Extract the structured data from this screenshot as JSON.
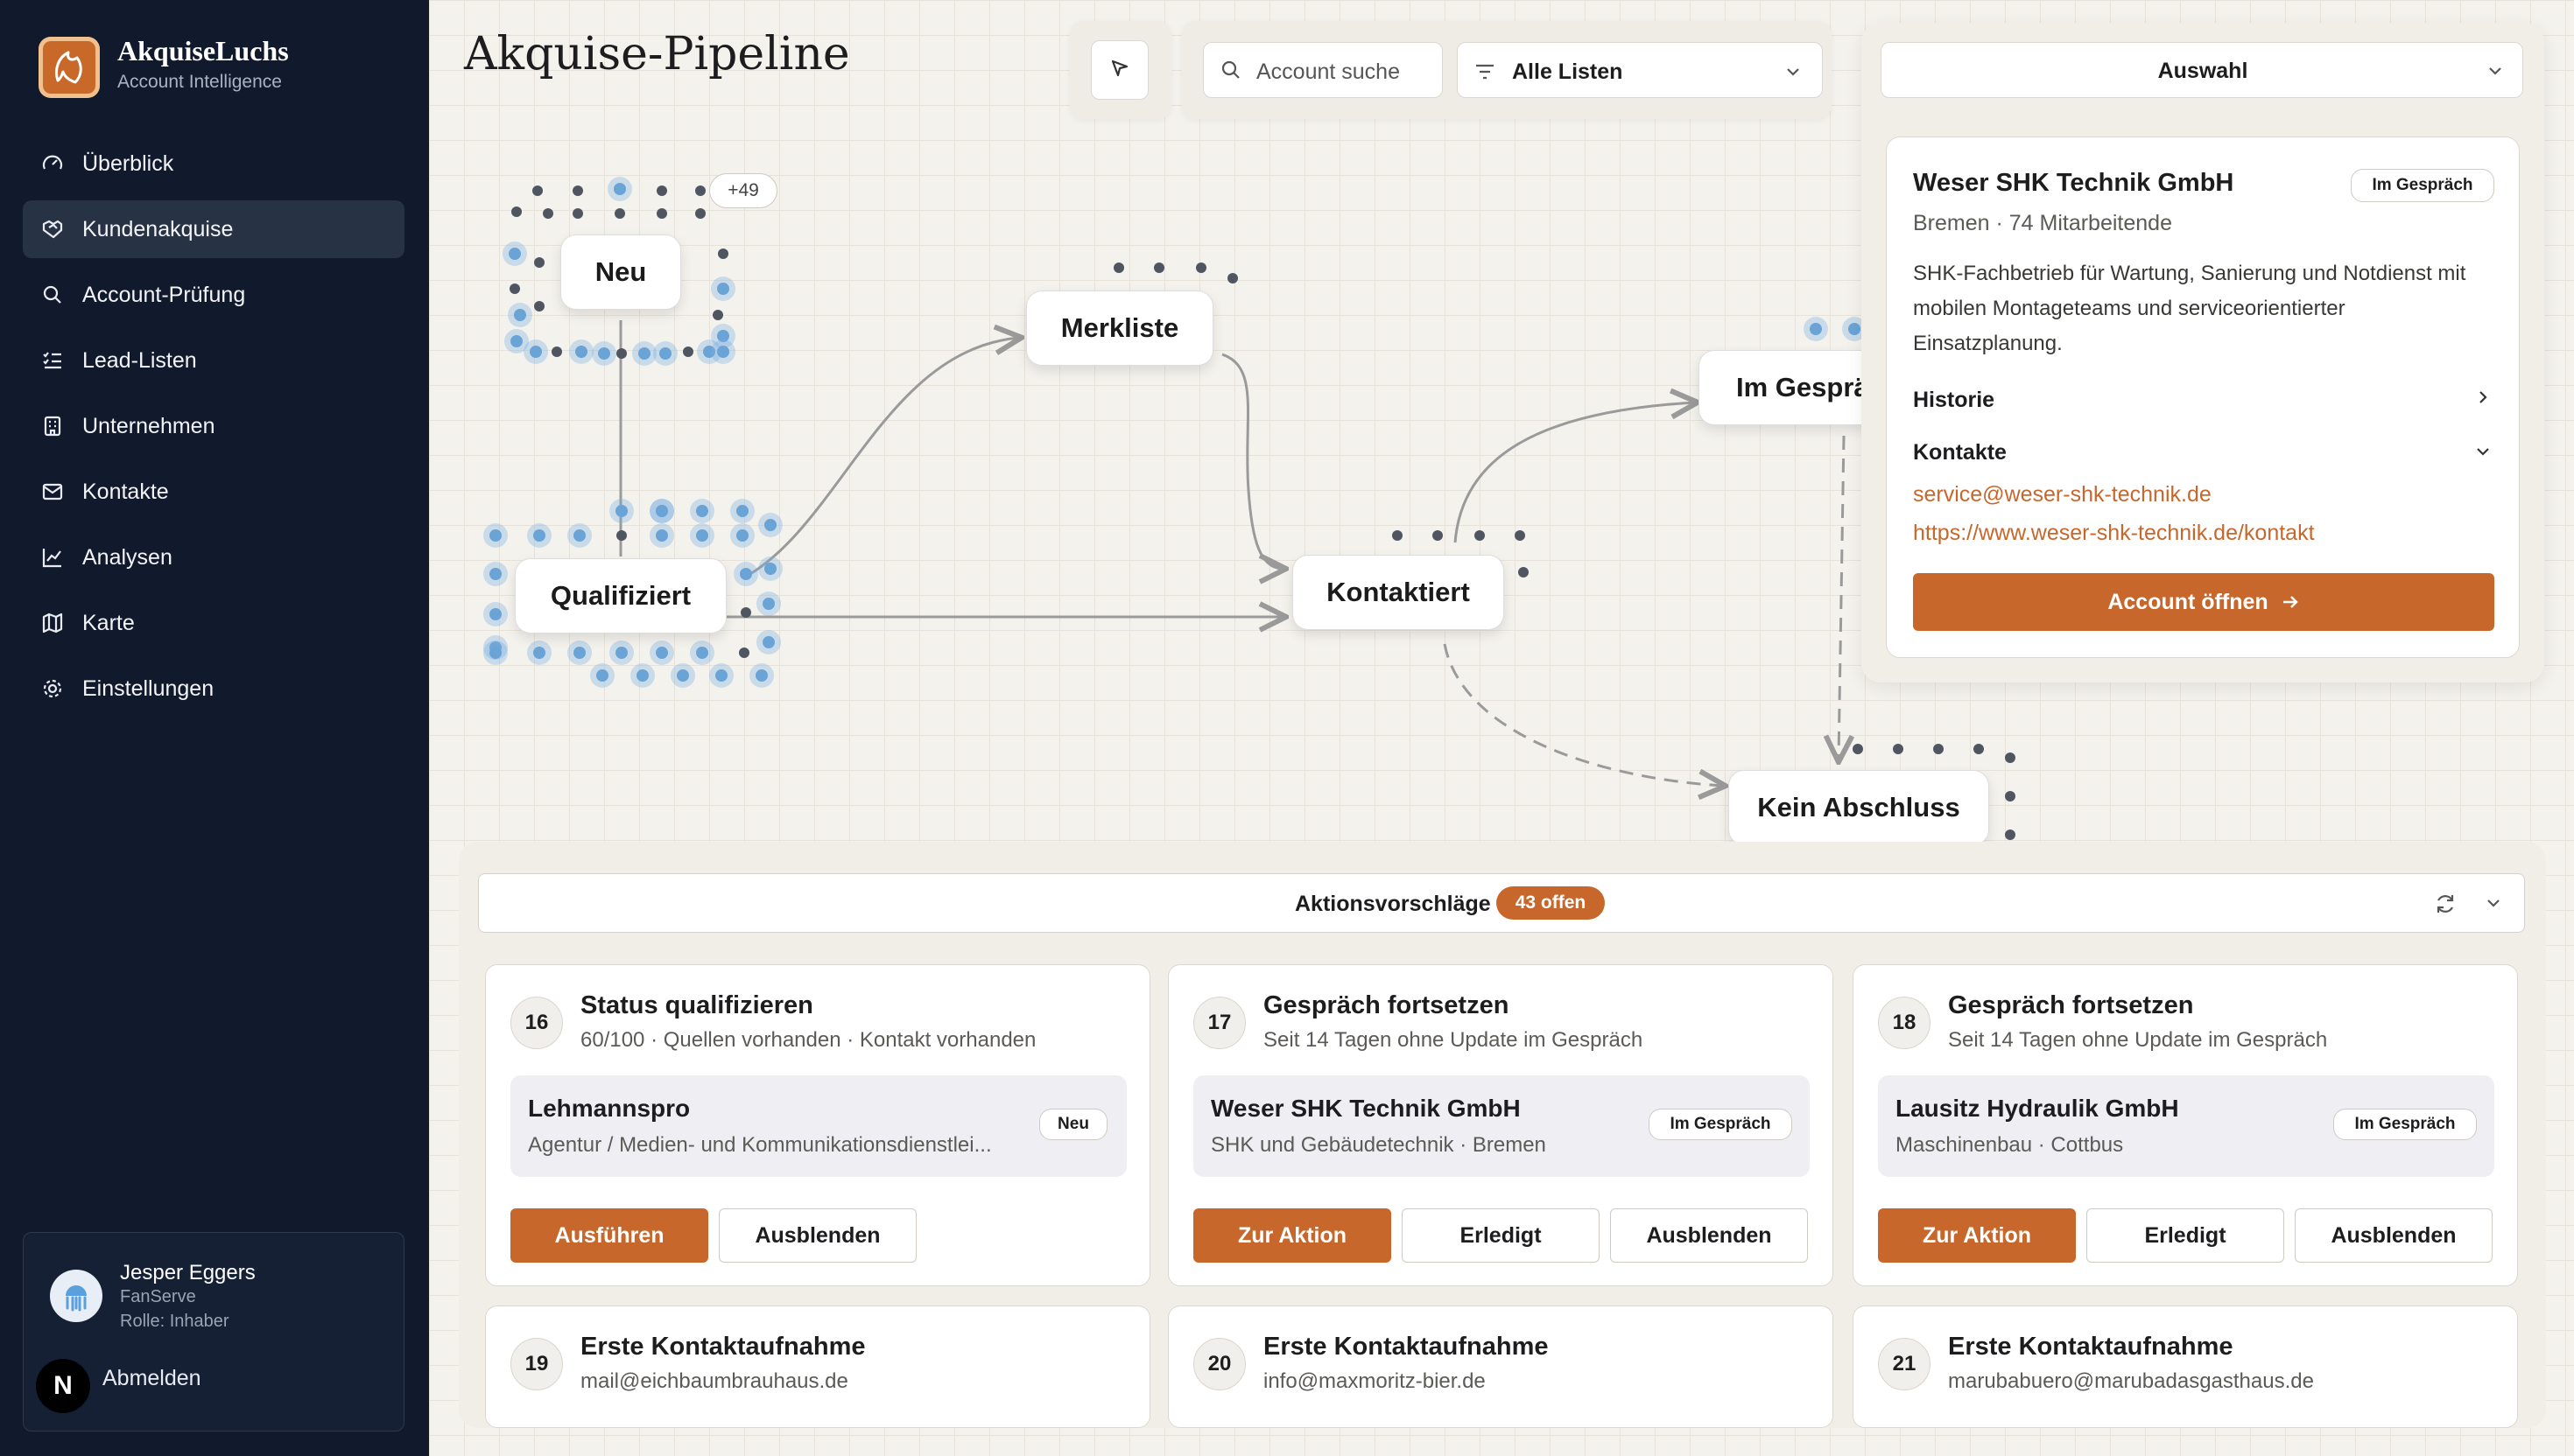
{
  "app": {
    "name": "AkquiseLuchs",
    "subtitle": "Account Intelligence"
  },
  "nav": [
    {
      "label": "Überblick",
      "icon": "gauge-icon",
      "active": false
    },
    {
      "label": "Kundenakquise",
      "icon": "handshake-icon",
      "active": true
    },
    {
      "label": "Account-Prüfung",
      "icon": "search-icon",
      "active": false
    },
    {
      "label": "Lead-Listen",
      "icon": "list-check-icon",
      "active": false
    },
    {
      "label": "Unternehmen",
      "icon": "building-icon",
      "active": false
    },
    {
      "label": "Kontakte",
      "icon": "mail-icon",
      "active": false
    },
    {
      "label": "Analysen",
      "icon": "chart-icon",
      "active": false
    },
    {
      "label": "Karte",
      "icon": "map-icon",
      "active": false
    },
    {
      "label": "Einstellungen",
      "icon": "gear-icon",
      "active": false
    }
  ],
  "user": {
    "name": "Jesper Eggers",
    "org": "FanServe",
    "role": "Rolle: Inhaber",
    "logout": "Abmelden",
    "badge": "N"
  },
  "page": {
    "title": "Akquise-Pipeline"
  },
  "toolbar": {
    "search_placeholder": "Account suche",
    "filter_value": "Alle Listen"
  },
  "pipeline": {
    "nodes": [
      "Neu",
      "Merkliste",
      "Im Gespräch",
      "Qualifiziert",
      "Kontaktiert",
      "Kein Abschluss"
    ],
    "overflow_badge": "+49"
  },
  "selection": {
    "dropdown": "Auswahl",
    "company": "Weser SHK Technik GmbH",
    "status": "Im Gespräch",
    "meta": "Bremen · 74 Mitarbeitende",
    "description": "SHK-Fachbetrieb für Wartung, Sanierung und Notdienst mit mobilen Montageteams und serviceorientierter Einsatzplanung.",
    "history_label": "Historie",
    "contacts_label": "Kontakte",
    "email": "service@weser-shk-technik.de",
    "url": "https://www.weser-shk-technik.de/kontakt",
    "open_button": "Account öffnen"
  },
  "actions": {
    "title": "Aktionsvorschläge",
    "badge": "43 offen",
    "cards": [
      {
        "num": "16",
        "title": "Status qualifizieren",
        "sub": "60/100 · Quellen vorhanden · Kontakt vorhanden",
        "company": "Lehmannspro",
        "company_sub": "Agentur / Medien- und Kommunikationsdienstlei...",
        "status": "Neu",
        "buttons": [
          "Ausführen",
          "Ausblenden"
        ]
      },
      {
        "num": "17",
        "title": "Gespräch fortsetzen",
        "sub": "Seit 14 Tagen ohne Update im Gespräch",
        "company": "Weser SHK Technik GmbH",
        "company_sub": "SHK und Gebäudetechnik · Bremen",
        "status": "Im Gespräch",
        "buttons": [
          "Zur Aktion",
          "Erledigt",
          "Ausblenden"
        ]
      },
      {
        "num": "18",
        "title": "Gespräch fortsetzen",
        "sub": "Seit 14 Tagen ohne Update im Gespräch",
        "company": "Lausitz Hydraulik GmbH",
        "company_sub": "Maschinenbau · Cottbus",
        "status": "Im Gespräch",
        "buttons": [
          "Zur Aktion",
          "Erledigt",
          "Ausblenden"
        ]
      },
      {
        "num": "19",
        "title": "Erste Kontaktaufnahme",
        "sub": "mail@eichbaumbrauhaus.de"
      },
      {
        "num": "20",
        "title": "Erste Kontaktaufnahme",
        "sub": "info@maxmoritz-bier.de"
      },
      {
        "num": "21",
        "title": "Erste Kontaktaufnahme",
        "sub": "marubabuero@marubadasgasthaus.de"
      }
    ]
  },
  "colors": {
    "accent": "#c7672c",
    "sidebar": "#111a2c",
    "canvas": "#f4f2ed"
  }
}
